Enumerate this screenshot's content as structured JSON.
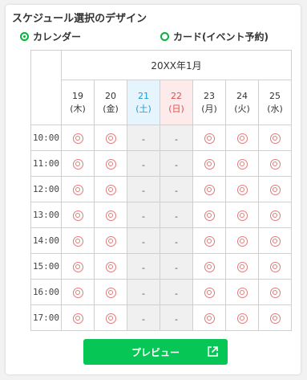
{
  "title": "スケジュール選択のデザイン",
  "options": [
    {
      "label": "カレンダー",
      "selected": true
    },
    {
      "label": "カード(イベント予約)",
      "selected": false
    }
  ],
  "accent_color": "#06c755",
  "calendar": {
    "month": "20XX年1月",
    "days": [
      {
        "num": "19",
        "wd": "(木)",
        "type": "weekday"
      },
      {
        "num": "20",
        "wd": "(金)",
        "type": "weekday"
      },
      {
        "num": "21",
        "wd": "(土)",
        "type": "saturday"
      },
      {
        "num": "22",
        "wd": "(日)",
        "type": "sunday"
      },
      {
        "num": "23",
        "wd": "(月)",
        "type": "weekday"
      },
      {
        "num": "24",
        "wd": "(火)",
        "type": "weekday"
      },
      {
        "num": "25",
        "wd": "(水)",
        "type": "weekday"
      }
    ],
    "times": [
      "10:00",
      "11:00",
      "12:00",
      "13:00",
      "14:00",
      "15:00",
      "16:00",
      "17:00"
    ],
    "availability": [
      [
        "◎",
        "◎",
        "-",
        "-",
        "◎",
        "◎",
        "◎"
      ],
      [
        "◎",
        "◎",
        "-",
        "-",
        "◎",
        "◎",
        "◎"
      ],
      [
        "◎",
        "◎",
        "-",
        "-",
        "◎",
        "◎",
        "◎"
      ],
      [
        "◎",
        "◎",
        "-",
        "-",
        "◎",
        "◎",
        "◎"
      ],
      [
        "◎",
        "◎",
        "-",
        "-",
        "◎",
        "◎",
        "◎"
      ],
      [
        "◎",
        "◎",
        "-",
        "-",
        "◎",
        "◎",
        "◎"
      ],
      [
        "◎",
        "◎",
        "-",
        "-",
        "◎",
        "◎",
        "◎"
      ],
      [
        "◎",
        "◎",
        "-",
        "-",
        "◎",
        "◎",
        "◎"
      ]
    ]
  },
  "preview_button": {
    "label": "プレビュー",
    "icon": "external-link-icon"
  }
}
